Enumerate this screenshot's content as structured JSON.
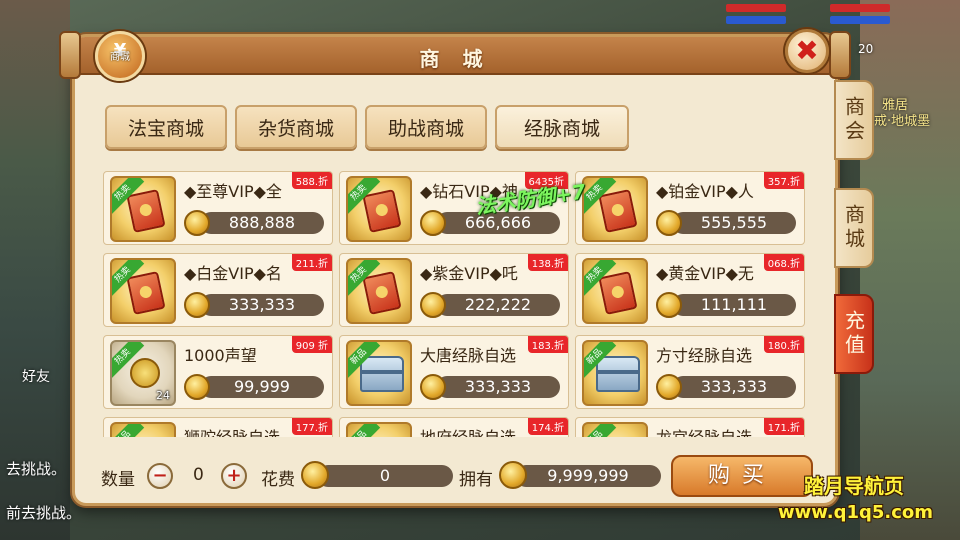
{
  "window": {
    "title": "商 城",
    "badge_label": "商城"
  },
  "tabs": [
    {
      "label": "法宝商城",
      "active": false
    },
    {
      "label": "杂货商城",
      "active": false
    },
    {
      "label": "助战商城",
      "active": false
    },
    {
      "label": "经脉商城",
      "active": true
    }
  ],
  "floating_text": "法术防御+7",
  "items": [
    {
      "name": "◆至尊VIP◆全",
      "discount": "588.折",
      "price": "888,888",
      "ribbon": "热卖",
      "icon": "vip-ticket-icon"
    },
    {
      "name": "◆钻石VIP◆神",
      "discount": "6435折",
      "price": "666,666",
      "ribbon": "热卖",
      "icon": "vip-ticket-icon"
    },
    {
      "name": "◆铂金VIP◆人",
      "discount": "357.折",
      "price": "555,555",
      "ribbon": "热卖",
      "icon": "vip-ticket-icon"
    },
    {
      "name": "◆白金VIP◆名",
      "discount": "211.折",
      "price": "333,333",
      "ribbon": "热卖",
      "icon": "vip-ticket-icon"
    },
    {
      "name": "◆紫金VIP◆吒",
      "discount": "138.折",
      "price": "222,222",
      "ribbon": "热卖",
      "icon": "vip-ticket-icon"
    },
    {
      "name": "◆黄金VIP◆无",
      "discount": "068.折",
      "price": "111,111",
      "ribbon": "热卖",
      "icon": "vip-ticket-icon"
    },
    {
      "name": "1000声望",
      "discount": "909 折",
      "price": "99,999",
      "ribbon": "热卖",
      "icon": "reputation-coin-icon",
      "qty": "24"
    },
    {
      "name": "大唐经脉自选",
      "discount": "183.折",
      "price": "333,333",
      "ribbon": "新品",
      "icon": "treasure-chest-icon"
    },
    {
      "name": "方寸经脉自选",
      "discount": "180.折",
      "price": "333,333",
      "ribbon": "新品",
      "icon": "treasure-chest-icon"
    },
    {
      "name": "狮驼经脉自选",
      "discount": "177.折",
      "price": "",
      "ribbon": "新品",
      "icon": "treasure-chest-icon"
    },
    {
      "name": "地府经脉自选",
      "discount": "174.折",
      "price": "",
      "ribbon": "新品",
      "icon": "treasure-chest-icon"
    },
    {
      "name": "龙宫经脉自选",
      "discount": "171.折",
      "price": "",
      "ribbon": "新品",
      "icon": "treasure-chest-icon"
    }
  ],
  "bottom": {
    "qty_label": "数量",
    "qty_value": "0",
    "minus": "−",
    "plus": "+",
    "cost_label": "花费",
    "cost_value": "0",
    "own_label": "拥有",
    "own_value": "9,999,999",
    "buy_label": "购买"
  },
  "side_tabs": [
    "商会",
    "商城",
    "充值"
  ],
  "background": {
    "left_texts": [
      "好友",
      "去挑战。",
      "前去挑战。"
    ],
    "right_texts": [
      "雅居",
      "戒·地城墨"
    ],
    "right_level": "20"
  },
  "watermark": {
    "line1": "踏月导航页",
    "line2": "www.q1q5.com"
  }
}
